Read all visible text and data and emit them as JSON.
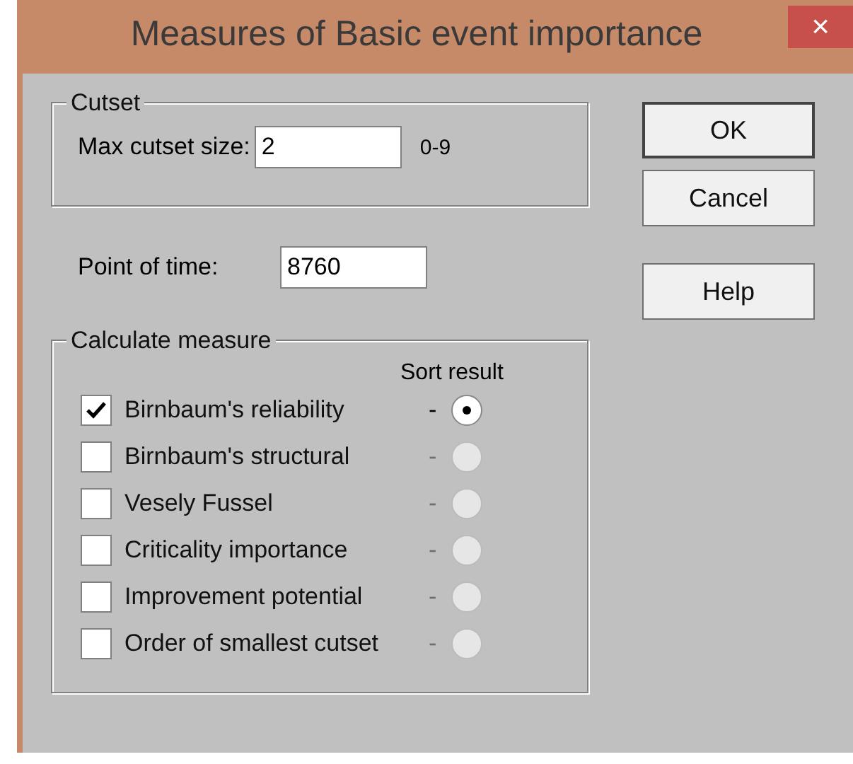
{
  "window": {
    "title": "Measures of Basic event importance",
    "close": "×"
  },
  "cutset": {
    "legend": "Cutset",
    "label": "Max cutset size:",
    "value": "2",
    "range": "0-9"
  },
  "time": {
    "label": "Point of time:",
    "value": "8760"
  },
  "measure": {
    "legend": "Calculate measure",
    "sort_heading": "Sort result",
    "rows": [
      {
        "label": "Birnbaum's reliability",
        "checked": true,
        "dash": "-",
        "sort_enabled": true,
        "selected": true
      },
      {
        "label": "Birnbaum's structural",
        "checked": false,
        "dash": "-",
        "sort_enabled": false,
        "selected": false
      },
      {
        "label": "Vesely Fussel",
        "checked": false,
        "dash": "-",
        "sort_enabled": false,
        "selected": false
      },
      {
        "label": "Criticality importance",
        "checked": false,
        "dash": "-",
        "sort_enabled": false,
        "selected": false
      },
      {
        "label": "Improvement potential",
        "checked": false,
        "dash": "-",
        "sort_enabled": false,
        "selected": false
      },
      {
        "label": "Order of smallest cutset",
        "checked": false,
        "dash": "-",
        "sort_enabled": false,
        "selected": false
      }
    ]
  },
  "buttons": [
    {
      "label": "OK",
      "default": true
    },
    {
      "label": "Cancel",
      "default": false
    },
    {
      "label": "Help",
      "default": false
    }
  ]
}
